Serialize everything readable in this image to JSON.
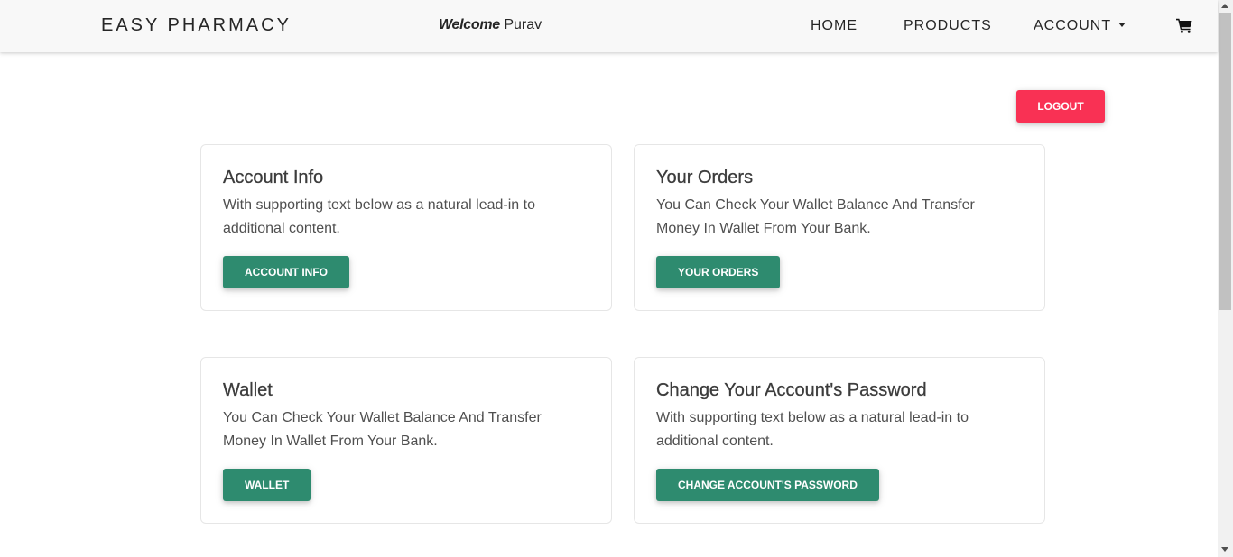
{
  "nav": {
    "brand": "EASY PHARMACY",
    "welcome_prefix": "Welcome",
    "user_name": "Purav",
    "links": {
      "home": "HOME",
      "products": "PRODUCTS",
      "account": "ACCOUNT"
    },
    "cart_icon": "shopping-cart-icon"
  },
  "logout_label": "LOGOUT",
  "cards": [
    {
      "title": "Account Info",
      "text": "With supporting text below as a natural lead-in to additional content.",
      "button": "ACCOUNT INFO"
    },
    {
      "title": "Your Orders",
      "text": "You Can Check Your Wallet Balance And Transfer Money In Wallet From Your Bank.",
      "button": "YOUR ORDERS"
    },
    {
      "title": "Wallet",
      "text": "You Can Check Your Wallet Balance And Transfer Money In Wallet From Your Bank.",
      "button": "WALLET"
    },
    {
      "title": "Change Your Account's Password",
      "text": "With supporting text below as a natural lead-in to additional content.",
      "button": "CHANGE ACCOUNT'S PASSWORD"
    }
  ],
  "colors": {
    "primary_button": "#2e8b6f",
    "logout_button": "#f93154",
    "navbar_bg": "#f8f8f8"
  }
}
